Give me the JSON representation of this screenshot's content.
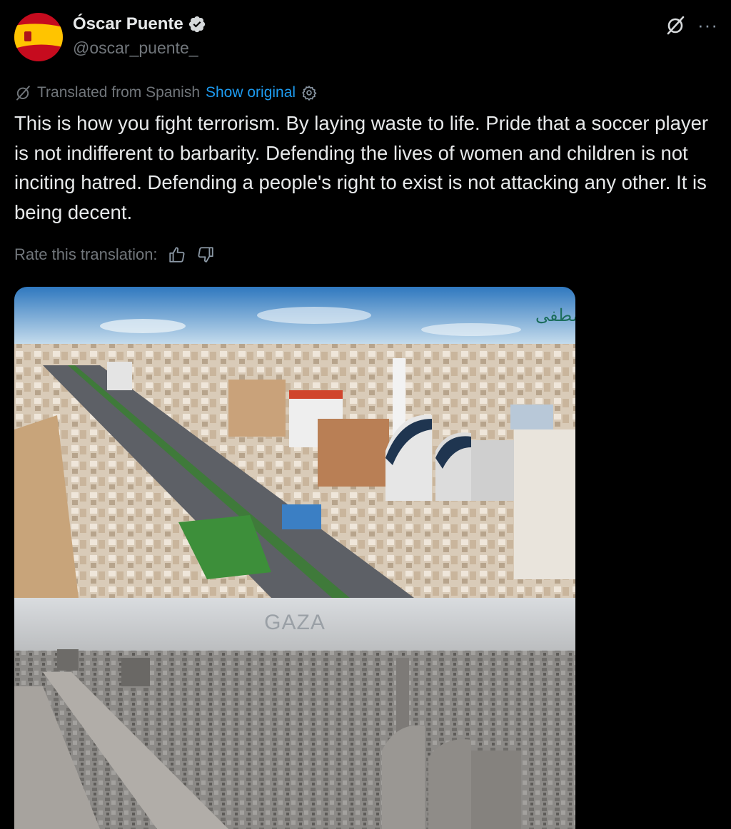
{
  "author": {
    "name": "Óscar Puente",
    "handle": "@oscar_puente_",
    "verified": true,
    "avatar_icon": "spain-flag-avatar"
  },
  "actions": {
    "grok_icon": "grok-icon",
    "more_label": "···"
  },
  "translation": {
    "translated_label": "Translated from Spanish",
    "show_original": "Show original"
  },
  "tweet": {
    "text": "This is how you fight terrorism. By laying waste to life. Pride that a soccer player is not indifferent to barbarity. Defending the lives of women and children is not inciting hatred. Defending a people's right to exist is not attacking any other. It is being decent."
  },
  "rate": {
    "label": "Rate this translation:"
  },
  "media": {
    "overlay_label": "GAZA",
    "colors": {
      "sky_top": "#3f86c6",
      "sky_bottom": "#cfe3f0",
      "rubble": "#8a8784"
    }
  },
  "colors": {
    "background": "#000000",
    "text": "#e7e9ea",
    "muted": "#71767b",
    "link": "#1d9bf0"
  }
}
